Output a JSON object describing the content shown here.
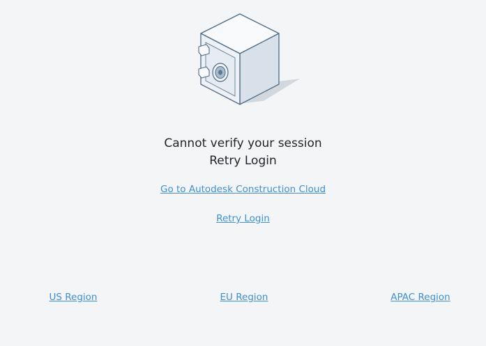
{
  "illustration": {
    "icon": "safe-icon"
  },
  "message": {
    "line1": "Cannot verify your session",
    "line2": "Retry Login"
  },
  "links": {
    "construction_cloud": "Go to Autodesk Construction Cloud",
    "retry_login": "Retry Login"
  },
  "regions": [
    {
      "label": "US Region"
    },
    {
      "label": "EU Region"
    },
    {
      "label": "APAC Region"
    }
  ],
  "colors": {
    "background": "#f4f5f7",
    "link": "#3d8fd6",
    "text": "#1f2329"
  }
}
